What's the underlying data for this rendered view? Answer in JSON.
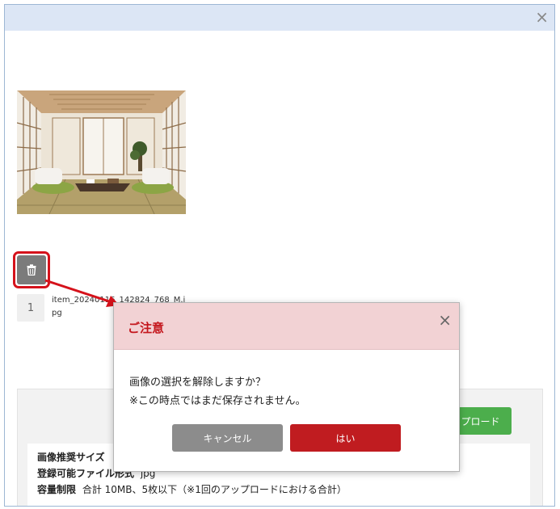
{
  "outer_modal": {
    "close_symbol": "×"
  },
  "image_item": {
    "index": "1",
    "filename": "item_20240116_142824_768_M.jpg"
  },
  "upload_panel": {
    "upload_button_label": "画像をアップロード",
    "recommended_size_label": "画像推奨サイズ",
    "formats_label": "登録可能ファイル形式",
    "formats_value": "jpg",
    "capacity_label": "容量制限",
    "capacity_value": "合計 10MB、5枚以下（※1回のアップロードにおける合計）"
  },
  "confirm_dialog": {
    "title": "ご注意",
    "close_symbol": "×",
    "message_line1": "画像の選択を解除しますか？",
    "message_line2": "※この時点ではまだ保存されません。",
    "cancel_label": "キャンセル",
    "yes_label": "はい"
  },
  "colors": {
    "annotation_red": "#d5121b",
    "dialog_header_bg": "#f2d2d4",
    "yes_button": "#c01c20",
    "cancel_button": "#8c8c8c",
    "upload_button": "#4cae4c",
    "outer_header_bg": "#dce6f5"
  },
  "icons": [
    "close-icon",
    "trash-icon",
    "arrow-annotation"
  ]
}
